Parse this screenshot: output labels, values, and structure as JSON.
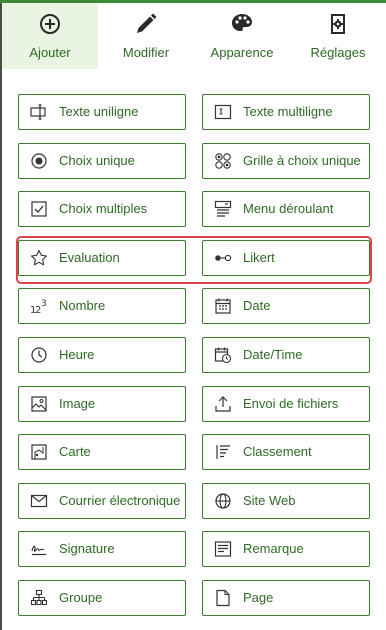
{
  "tabs": [
    {
      "label": "Ajouter",
      "icon": "add-circle-icon",
      "active": true
    },
    {
      "label": "Modifier",
      "icon": "pencil-icon",
      "active": false
    },
    {
      "label": "Apparence",
      "icon": "palette-icon",
      "active": false
    },
    {
      "label": "Réglages",
      "icon": "settings-doc-icon",
      "active": false
    }
  ],
  "questions": [
    {
      "label": "Texte uniligne",
      "icon": "single-line-text-icon"
    },
    {
      "label": "Texte multiligne",
      "icon": "multiline-text-icon"
    },
    {
      "label": "Choix unique",
      "icon": "radio-icon"
    },
    {
      "label": "Grille à choix unique",
      "icon": "radio-grid-icon"
    },
    {
      "label": "Choix multiples",
      "icon": "checkbox-icon"
    },
    {
      "label": "Menu déroulant",
      "icon": "dropdown-icon"
    },
    {
      "label": "Evaluation",
      "icon": "star-icon"
    },
    {
      "label": "Likert",
      "icon": "likert-icon"
    },
    {
      "label": "Nombre",
      "icon": "number-icon"
    },
    {
      "label": "Date",
      "icon": "calendar-icon"
    },
    {
      "label": "Heure",
      "icon": "clock-icon"
    },
    {
      "label": "Date/Time",
      "icon": "calendar-clock-icon"
    },
    {
      "label": "Image",
      "icon": "image-icon"
    },
    {
      "label": "Envoi de fichiers",
      "icon": "upload-icon"
    },
    {
      "label": "Carte",
      "icon": "map-icon"
    },
    {
      "label": "Classement",
      "icon": "ranking-icon"
    },
    {
      "label": "Courrier électronique",
      "icon": "email-icon"
    },
    {
      "label": "Site Web",
      "icon": "globe-icon"
    },
    {
      "label": "Signature",
      "icon": "signature-icon"
    },
    {
      "label": "Remarque",
      "icon": "note-icon"
    },
    {
      "label": "Groupe",
      "icon": "group-icon"
    },
    {
      "label": "Page",
      "icon": "page-icon"
    }
  ],
  "colors": {
    "accent": "#2e6b24",
    "border": "#3a7a2e",
    "active_tab_bg": "#eaf4e2",
    "highlight": "#e0444b"
  }
}
